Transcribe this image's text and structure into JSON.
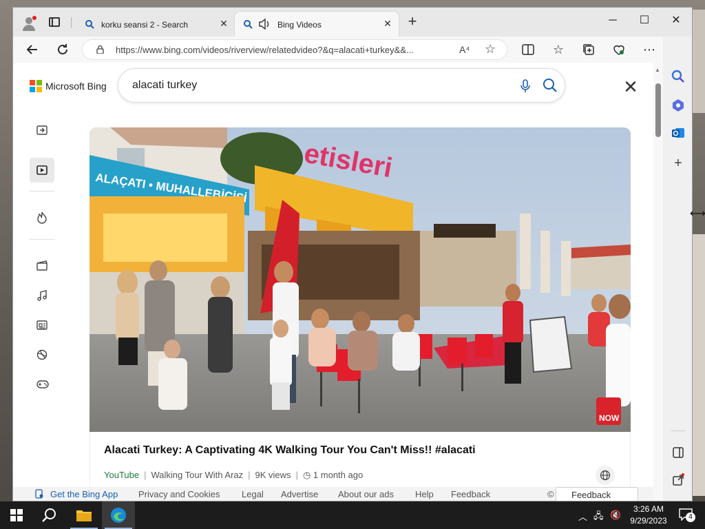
{
  "browser": {
    "tabs": [
      {
        "title": "korku seansi 2 - Search",
        "active": false
      },
      {
        "title": "Bing Videos",
        "active": true
      }
    ],
    "address": "https://www.bing.com/videos/riverview/relatedvideo?&q=alacati+turkey&&...",
    "read_aloud_label": "A⁴"
  },
  "bing": {
    "brand": "Microsoft Bing",
    "query": "alacati turkey",
    "video": {
      "title": "Alacati Turkey: A Captivating 4K Walking Tour You Can't Miss!! #alacati",
      "source": "YouTube",
      "channel": "Walking Tour With Araz",
      "views": "9K views",
      "age": "1 month ago",
      "shop_sign_left": "ALAÇATI • MUHALLEBİCİSİ",
      "shop_sign_main": "etisleri",
      "watermark": "NOW"
    },
    "footer": {
      "get_app": "Get the Bing App",
      "links": [
        "Privacy and Cookies",
        "Legal",
        "Advertise",
        "About our ads",
        "Help",
        "Feedback"
      ],
      "copyright": "©",
      "feedback_button": "Feedback"
    }
  },
  "taskbar": {
    "time": "3:26 AM",
    "date": "9/29/2023",
    "notification_count": "4"
  },
  "colors": {
    "accent": "#1a5fb4",
    "source_green": "#1b7a3b",
    "ms_red": "#f25022",
    "ms_green": "#7fba00",
    "ms_blue": "#00a4ef",
    "ms_yellow": "#ffb900"
  }
}
